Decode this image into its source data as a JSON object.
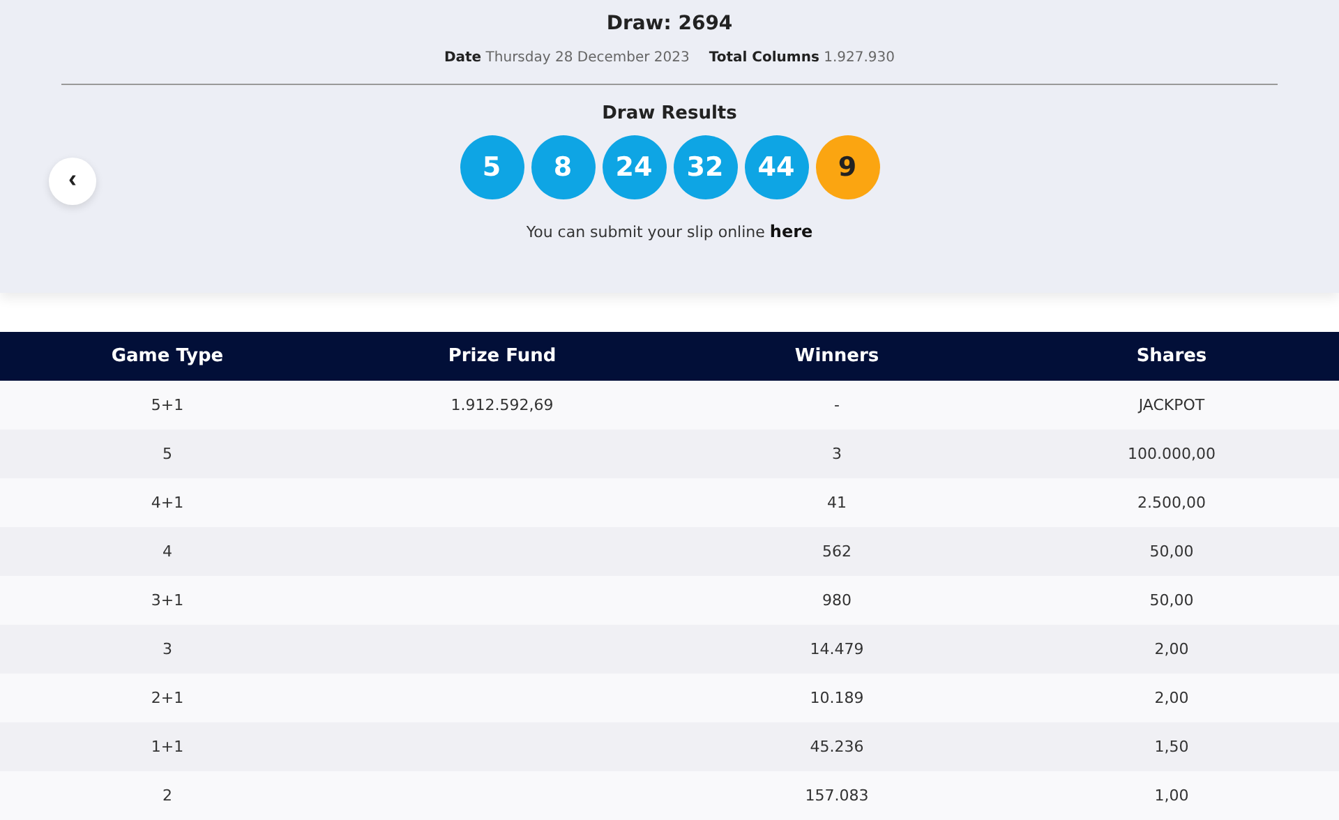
{
  "draw": {
    "title": "Draw: 2694",
    "date_label": "Date",
    "date": "Thursday 28 December 2023",
    "columns_label": "Total Columns",
    "columns": "1.927.930"
  },
  "results": {
    "title": "Draw Results",
    "balls": [
      {
        "number": "5",
        "kind": "main"
      },
      {
        "number": "8",
        "kind": "main"
      },
      {
        "number": "24",
        "kind": "main"
      },
      {
        "number": "32",
        "kind": "main"
      },
      {
        "number": "44",
        "kind": "main"
      },
      {
        "number": "9",
        "kind": "bonus"
      }
    ],
    "submit_text": "You can submit your slip online",
    "submit_link": "here",
    "back_icon": "‹"
  },
  "table": {
    "columns": [
      "Game Type",
      "Prize Fund",
      "Winners",
      "Shares"
    ],
    "rows": [
      [
        "5+1",
        "1.912.592,69",
        "-",
        "JACKPOT"
      ],
      [
        "5",
        "",
        "3",
        "100.000,00"
      ],
      [
        "4+1",
        "",
        "41",
        "2.500,00"
      ],
      [
        "4",
        "",
        "562",
        "50,00"
      ],
      [
        "3+1",
        "",
        "980",
        "50,00"
      ],
      [
        "3",
        "",
        "14.479",
        "2,00"
      ],
      [
        "2+1",
        "",
        "10.189",
        "2,00"
      ],
      [
        "1+1",
        "",
        "45.236",
        "1,50"
      ],
      [
        "2",
        "",
        "157.083",
        "1,00"
      ]
    ]
  }
}
